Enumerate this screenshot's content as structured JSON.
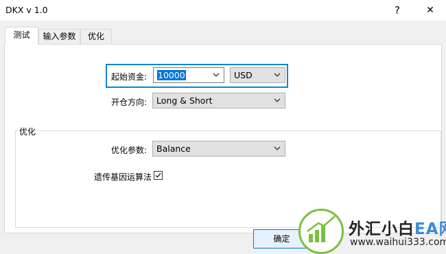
{
  "window": {
    "title": "DKX v 1.0",
    "help_glyph": "?",
    "close_glyph": "✕"
  },
  "tabs": [
    {
      "label": "测试",
      "active": true
    },
    {
      "label": "输入参数",
      "active": false
    },
    {
      "label": "优化",
      "active": false
    }
  ],
  "form": {
    "deposit_label": "起始资金:",
    "deposit_value": "10000",
    "currency_value": "USD",
    "direction_label": "开仓方向:",
    "direction_value": "Long & Short"
  },
  "optimization": {
    "group_label": "优化",
    "param_label": "优化参数:",
    "param_value": "Balance",
    "genetic_label": "遗传基因运算法",
    "genetic_checked": true
  },
  "buttons": {
    "ok_label": "确定"
  },
  "watermark": {
    "text_main": "外汇小白",
    "text_accent": "EA网",
    "url": "www.waihui333.com"
  },
  "colors": {
    "focus_border": "#0a84d6",
    "selection": "#0078d7",
    "watermark_green": "#7bbf3e",
    "watermark_blue": "#3b8cd9"
  }
}
